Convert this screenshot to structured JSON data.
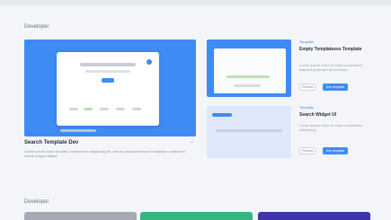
{
  "sections": {
    "featured": "Developer",
    "more": "Developer"
  },
  "hero": {
    "title": "Search Template Dev",
    "description": "Lorem ipsum dolor sit amet, consectetur adipiscing elit, sed do eiusmod tempor incididunt ut labore et dolore magna aliqua."
  },
  "side_cards": [
    {
      "tag": "Template",
      "title": "Empty Templatesss Template",
      "description": "Lorem ipsum dolor sit amet consectetur adipiscing elit sed do eiusmod",
      "secondary_label": "Preview",
      "primary_label": "Use template"
    },
    {
      "tag": "Template",
      "title": "Search Widget UI",
      "description": "Lorem ipsum dolor sit amet consectetur adipiscing",
      "secondary_label": "Preview",
      "primary_label": "Use template"
    }
  ],
  "colors": {
    "accent": "#3f8bf4",
    "bottom_cards": [
      "#a7aab6",
      "#36b583",
      "#3f33a9"
    ]
  }
}
